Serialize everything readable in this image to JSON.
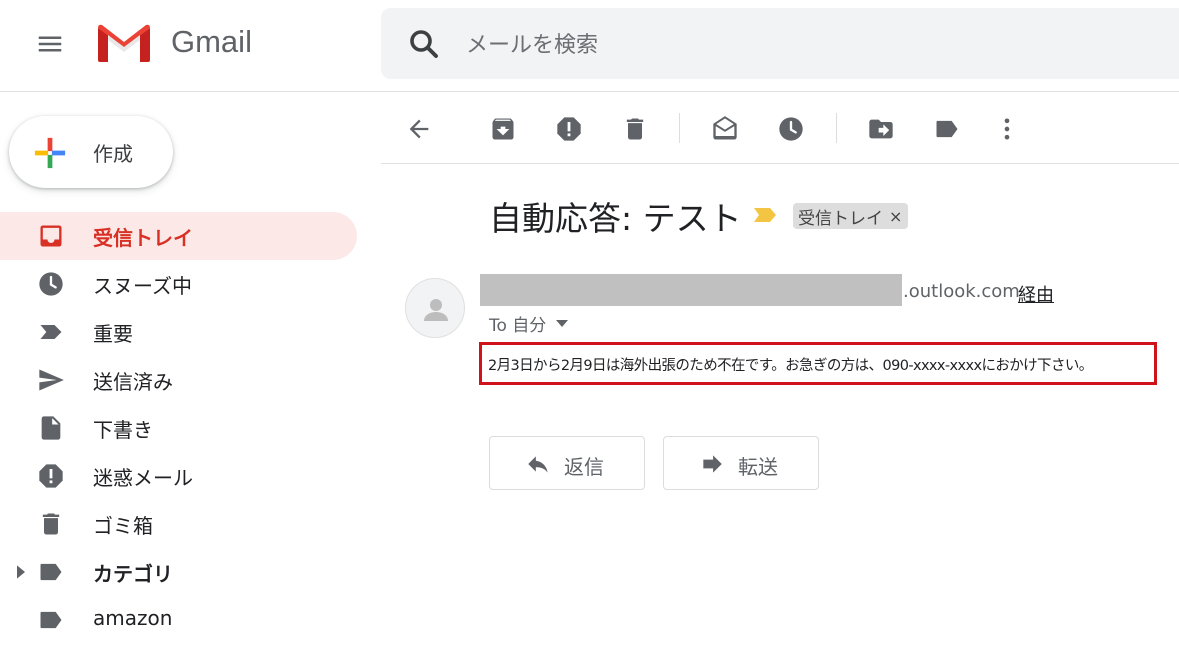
{
  "app": {
    "name": "Gmail"
  },
  "search": {
    "placeholder": "メールを検索"
  },
  "compose": {
    "label": "作成"
  },
  "sidebar": {
    "items": [
      {
        "label": "受信トレイ",
        "icon": "inbox-icon",
        "active": true
      },
      {
        "label": "スヌーズ中",
        "icon": "clock-icon"
      },
      {
        "label": "重要",
        "icon": "important-icon"
      },
      {
        "label": "送信済み",
        "icon": "send-icon"
      },
      {
        "label": "下書き",
        "icon": "draft-icon"
      },
      {
        "label": "迷惑メール",
        "icon": "spam-icon"
      },
      {
        "label": "ゴミ箱",
        "icon": "trash-icon"
      },
      {
        "label": "カテゴリ",
        "icon": "label-icon",
        "expandable": true
      },
      {
        "label": "amazon",
        "icon": "label-icon"
      }
    ]
  },
  "toolbar": {
    "icons": [
      "back-arrow-icon",
      "archive-icon",
      "report-spam-icon",
      "delete-icon",
      "mark-unread-icon",
      "snooze-icon",
      "move-to-icon",
      "labels-icon",
      "more-icon"
    ]
  },
  "message": {
    "subject": "自動応答: テスト",
    "label_chip": "受信トレイ",
    "label_chip_close": "×",
    "sender_domain": ".outlook.com",
    "via": "経由",
    "to": "To 自分",
    "body": "2月3日から2月9日は海外出張のため不在です。お急ぎの方は、090-xxxx-xxxxにおかけ下さい。"
  },
  "actions": {
    "reply": "返信",
    "forward": "転送"
  },
  "colors": {
    "accent_red": "#d93025",
    "active_bg": "#fce8e6",
    "icon_gray": "#5f6368",
    "highlight_border": "#d0121b",
    "importance_yellow": "#f4c542"
  }
}
